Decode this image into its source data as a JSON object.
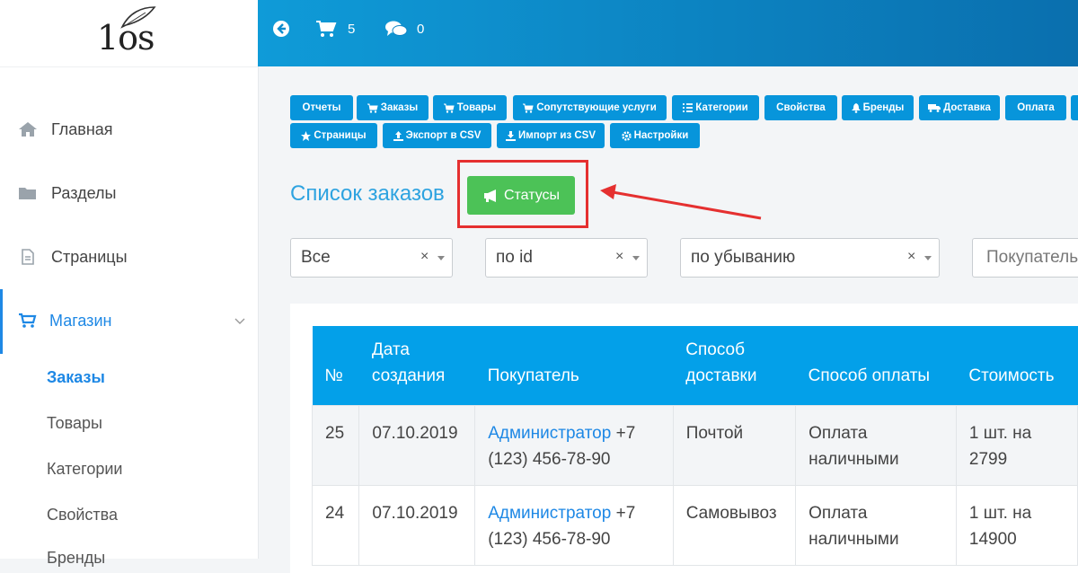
{
  "logo": {
    "text": "1os"
  },
  "sidebar": {
    "items": [
      {
        "label": "Главная",
        "icon": "home-icon"
      },
      {
        "label": "Разделы",
        "icon": "folder-icon"
      },
      {
        "label": "Страницы",
        "icon": "file-icon"
      },
      {
        "label": "Магазин",
        "icon": "cart-icon"
      }
    ],
    "subitems": [
      "Заказы",
      "Товары",
      "Категории",
      "Свойства",
      "Бренды"
    ]
  },
  "topbar": {
    "cart_count": "5",
    "comments_count": "0"
  },
  "toolbar": {
    "row1": [
      "Отчеты",
      "Заказы",
      "Товары",
      "Сопутствующие услуги",
      "Категории",
      "Свойства",
      "Бренды",
      "Доставка",
      "Оплата"
    ],
    "row2": [
      "Страницы",
      "Экспорт в CSV",
      "Импорт из CSV",
      "Настройки"
    ]
  },
  "page": {
    "title": "Список заказов",
    "statuses_label": "Статусы"
  },
  "filters": {
    "status": "Все",
    "sort_by": "по id",
    "order": "по убыванию",
    "clear": "×",
    "buyer_placeholder": "Покупатель"
  },
  "table": {
    "headers": {
      "num": "№",
      "date_l1": "Дата",
      "date_l2": "создания",
      "buyer": "Покупатель",
      "delivery_l1": "Способ",
      "delivery_l2": "доставки",
      "payment": "Способ оплаты",
      "cost": "Стоимость"
    },
    "rows": [
      {
        "num": "25",
        "date": "07.10.2019",
        "buyer_name": "Администратор",
        "phone_a": "+7",
        "phone_b": "(123) 456-78-90",
        "delivery": "Почтой",
        "pay_l1": "Оплата",
        "pay_l2": "наличными",
        "cost_l1": "1 шт. на",
        "cost_l2": "2799"
      },
      {
        "num": "24",
        "date": "07.10.2019",
        "buyer_name": "Администратор",
        "phone_a": "+7",
        "phone_b": "(123) 456-78-90",
        "delivery": "Самовывоз",
        "pay_l1": "Оплата",
        "pay_l2": "наличными",
        "cost_l1": "1 шт. на",
        "cost_l2": "14900"
      }
    ]
  },
  "colors": {
    "accent": "#0795db",
    "success": "#4cc257",
    "highlight": "#e53030"
  }
}
